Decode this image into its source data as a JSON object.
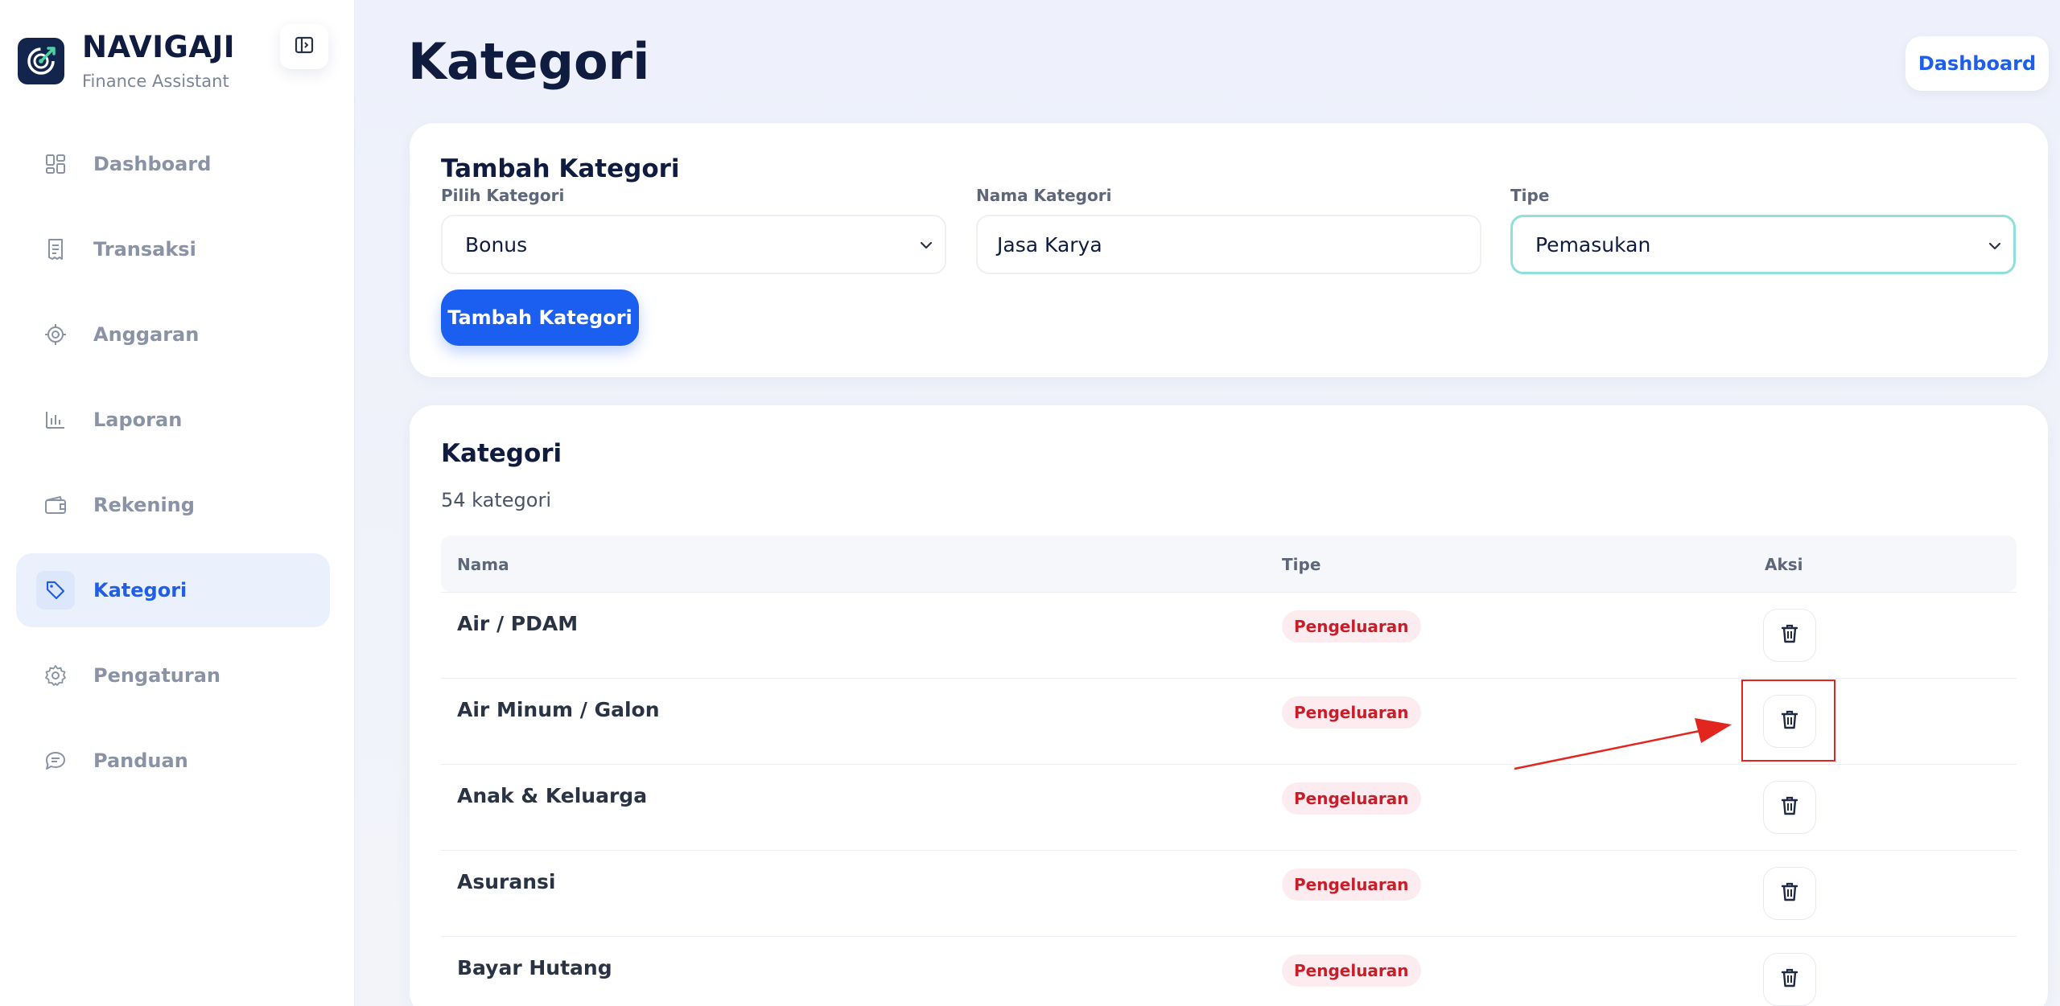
{
  "brand": {
    "title": "NAVIGAJI",
    "subtitle": "Finance Assistant"
  },
  "sidebar": {
    "items": [
      {
        "label": "Dashboard",
        "icon": "dashboard-grid-icon",
        "active": false
      },
      {
        "label": "Transaksi",
        "icon": "receipt-icon",
        "active": false
      },
      {
        "label": "Anggaran",
        "icon": "target-icon",
        "active": false
      },
      {
        "label": "Laporan",
        "icon": "bar-chart-icon",
        "active": false
      },
      {
        "label": "Rekening",
        "icon": "wallet-icon",
        "active": false
      },
      {
        "label": "Kategori",
        "icon": "tag-icon",
        "active": true
      },
      {
        "label": "Pengaturan",
        "icon": "gear-icon",
        "active": false
      },
      {
        "label": "Panduan",
        "icon": "chat-icon",
        "active": false
      }
    ]
  },
  "header": {
    "title": "Kategori",
    "dashboard_button": "Dashboard"
  },
  "add_form": {
    "title": "Tambah Kategori",
    "select_category_label": "Pilih Kategori",
    "select_category_value": "Bonus",
    "name_label": "Nama Kategori",
    "name_value": "Jasa Karya",
    "type_label": "Tipe",
    "type_value": "Pemasukan",
    "submit_label": "Tambah Kategori"
  },
  "list": {
    "title": "Kategori",
    "count_text": "54 kategori",
    "columns": [
      "Nama",
      "Tipe",
      "Aksi"
    ],
    "rows": [
      {
        "name": "Air / PDAM",
        "type": "Pengeluaran"
      },
      {
        "name": "Air Minum / Galon",
        "type": "Pengeluaran"
      },
      {
        "name": "Anak & Keluarga",
        "type": "Pengeluaran"
      },
      {
        "name": "Asuransi",
        "type": "Pengeluaran"
      },
      {
        "name": "Bayar Hutang",
        "type": "Pengeluaran"
      }
    ]
  },
  "colors": {
    "accent": "#1a5ff0",
    "expense_badge_bg": "#fdecef",
    "expense_badge_text": "#c81e2a",
    "annotation": "#e2261f"
  }
}
